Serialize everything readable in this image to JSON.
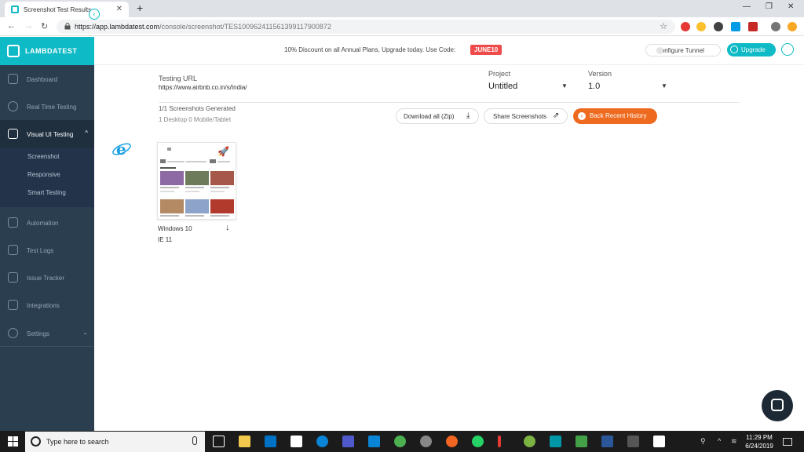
{
  "browser": {
    "tab_title": "Screenshot Test Results",
    "new_tab_label": "+",
    "url_domain": "https://app.lambdatest.com",
    "url_path": "/console/screenshot/TES100962411561399117900872"
  },
  "sidebar": {
    "brand": "LAMBDATEST",
    "items": [
      {
        "label": "Dashboard",
        "icon": "dashboard-icon"
      },
      {
        "label": "Real Time Testing",
        "icon": "clock-icon"
      },
      {
        "label": "Visual UI Testing",
        "icon": "eye-icon",
        "active": true
      },
      {
        "label": "Automation",
        "icon": "robot-icon"
      },
      {
        "label": "Test Logs",
        "icon": "cube-icon"
      },
      {
        "label": "Issue Tracker",
        "icon": "bug-icon"
      },
      {
        "label": "Integrations",
        "icon": "integrations-icon"
      },
      {
        "label": "Settings",
        "icon": "gear-icon"
      }
    ],
    "sub_items": [
      "Screenshot",
      "Responsive",
      "Smart Testing"
    ]
  },
  "header": {
    "promo_text": "10% Discount on all Annual Plans, Upgrade today. Use Code:",
    "coupon_code": "JUNE10",
    "configure_tunnel": "Configure Tunnel",
    "upgrade": "Upgrade"
  },
  "main": {
    "testing_url_label": "Testing URL",
    "testing_url_value": "https://www.airbnb.co.in/s/India/",
    "project_label": "Project",
    "project_value": "Untitled",
    "version_label": "Version",
    "version_value": "1.0",
    "generated_text": "1/1 Screenshots Generated",
    "breakdown_text": "1 Desktop 0 Mobile/Tablet",
    "download_all": "Download all (Zip)",
    "share_screenshots": "Share Screenshots",
    "back_history": "Back Recent History",
    "result": {
      "os": "Windows 10",
      "browser": "IE 11"
    }
  },
  "taskbar": {
    "search_placeholder": "Type here to search",
    "time": "11:29 PM",
    "date": "6/24/2019"
  },
  "colors": {
    "accent": "#0ebac5",
    "sidebar": "#2b3e50",
    "orange": "#ee6a1f",
    "coupon": "#f04b4b"
  }
}
